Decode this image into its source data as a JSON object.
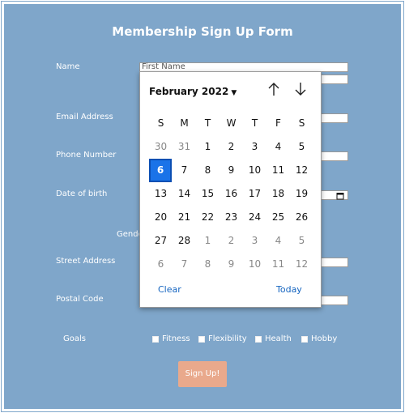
{
  "form": {
    "title": "Membership Sign Up Form",
    "labels": {
      "name": "Name",
      "email": "Email Address",
      "phone": "Phone Number",
      "dob": "Date of birth",
      "gender": "Gende",
      "street": "Street Address",
      "postal": "Postal Code",
      "goals": "Goals"
    },
    "placeholders": {
      "first_name": "First Name"
    },
    "goals": [
      "Fitness",
      "Flexibility",
      "Health",
      "Hobby"
    ],
    "submit_label": "Sign Up!"
  },
  "calendar": {
    "month_label": "February 2022",
    "weekdays": [
      "S",
      "M",
      "T",
      "W",
      "T",
      "F",
      "S"
    ],
    "weeks": [
      [
        "30",
        "31",
        "1",
        "2",
        "3",
        "4",
        "5"
      ],
      [
        "6",
        "7",
        "8",
        "9",
        "10",
        "11",
        "12"
      ],
      [
        "13",
        "14",
        "15",
        "16",
        "17",
        "18",
        "19"
      ],
      [
        "20",
        "21",
        "22",
        "23",
        "24",
        "25",
        "26"
      ],
      [
        "27",
        "28",
        "1",
        "2",
        "3",
        "4",
        "5"
      ],
      [
        "6",
        "7",
        "8",
        "9",
        "10",
        "11",
        "12"
      ]
    ],
    "selected": "6",
    "clear_label": "Clear",
    "today_label": "Today"
  },
  "colors": {
    "background": "#7fa6ca",
    "button": "#e9a98c",
    "selected_day": "#1a73e8",
    "link": "#1565c0"
  }
}
